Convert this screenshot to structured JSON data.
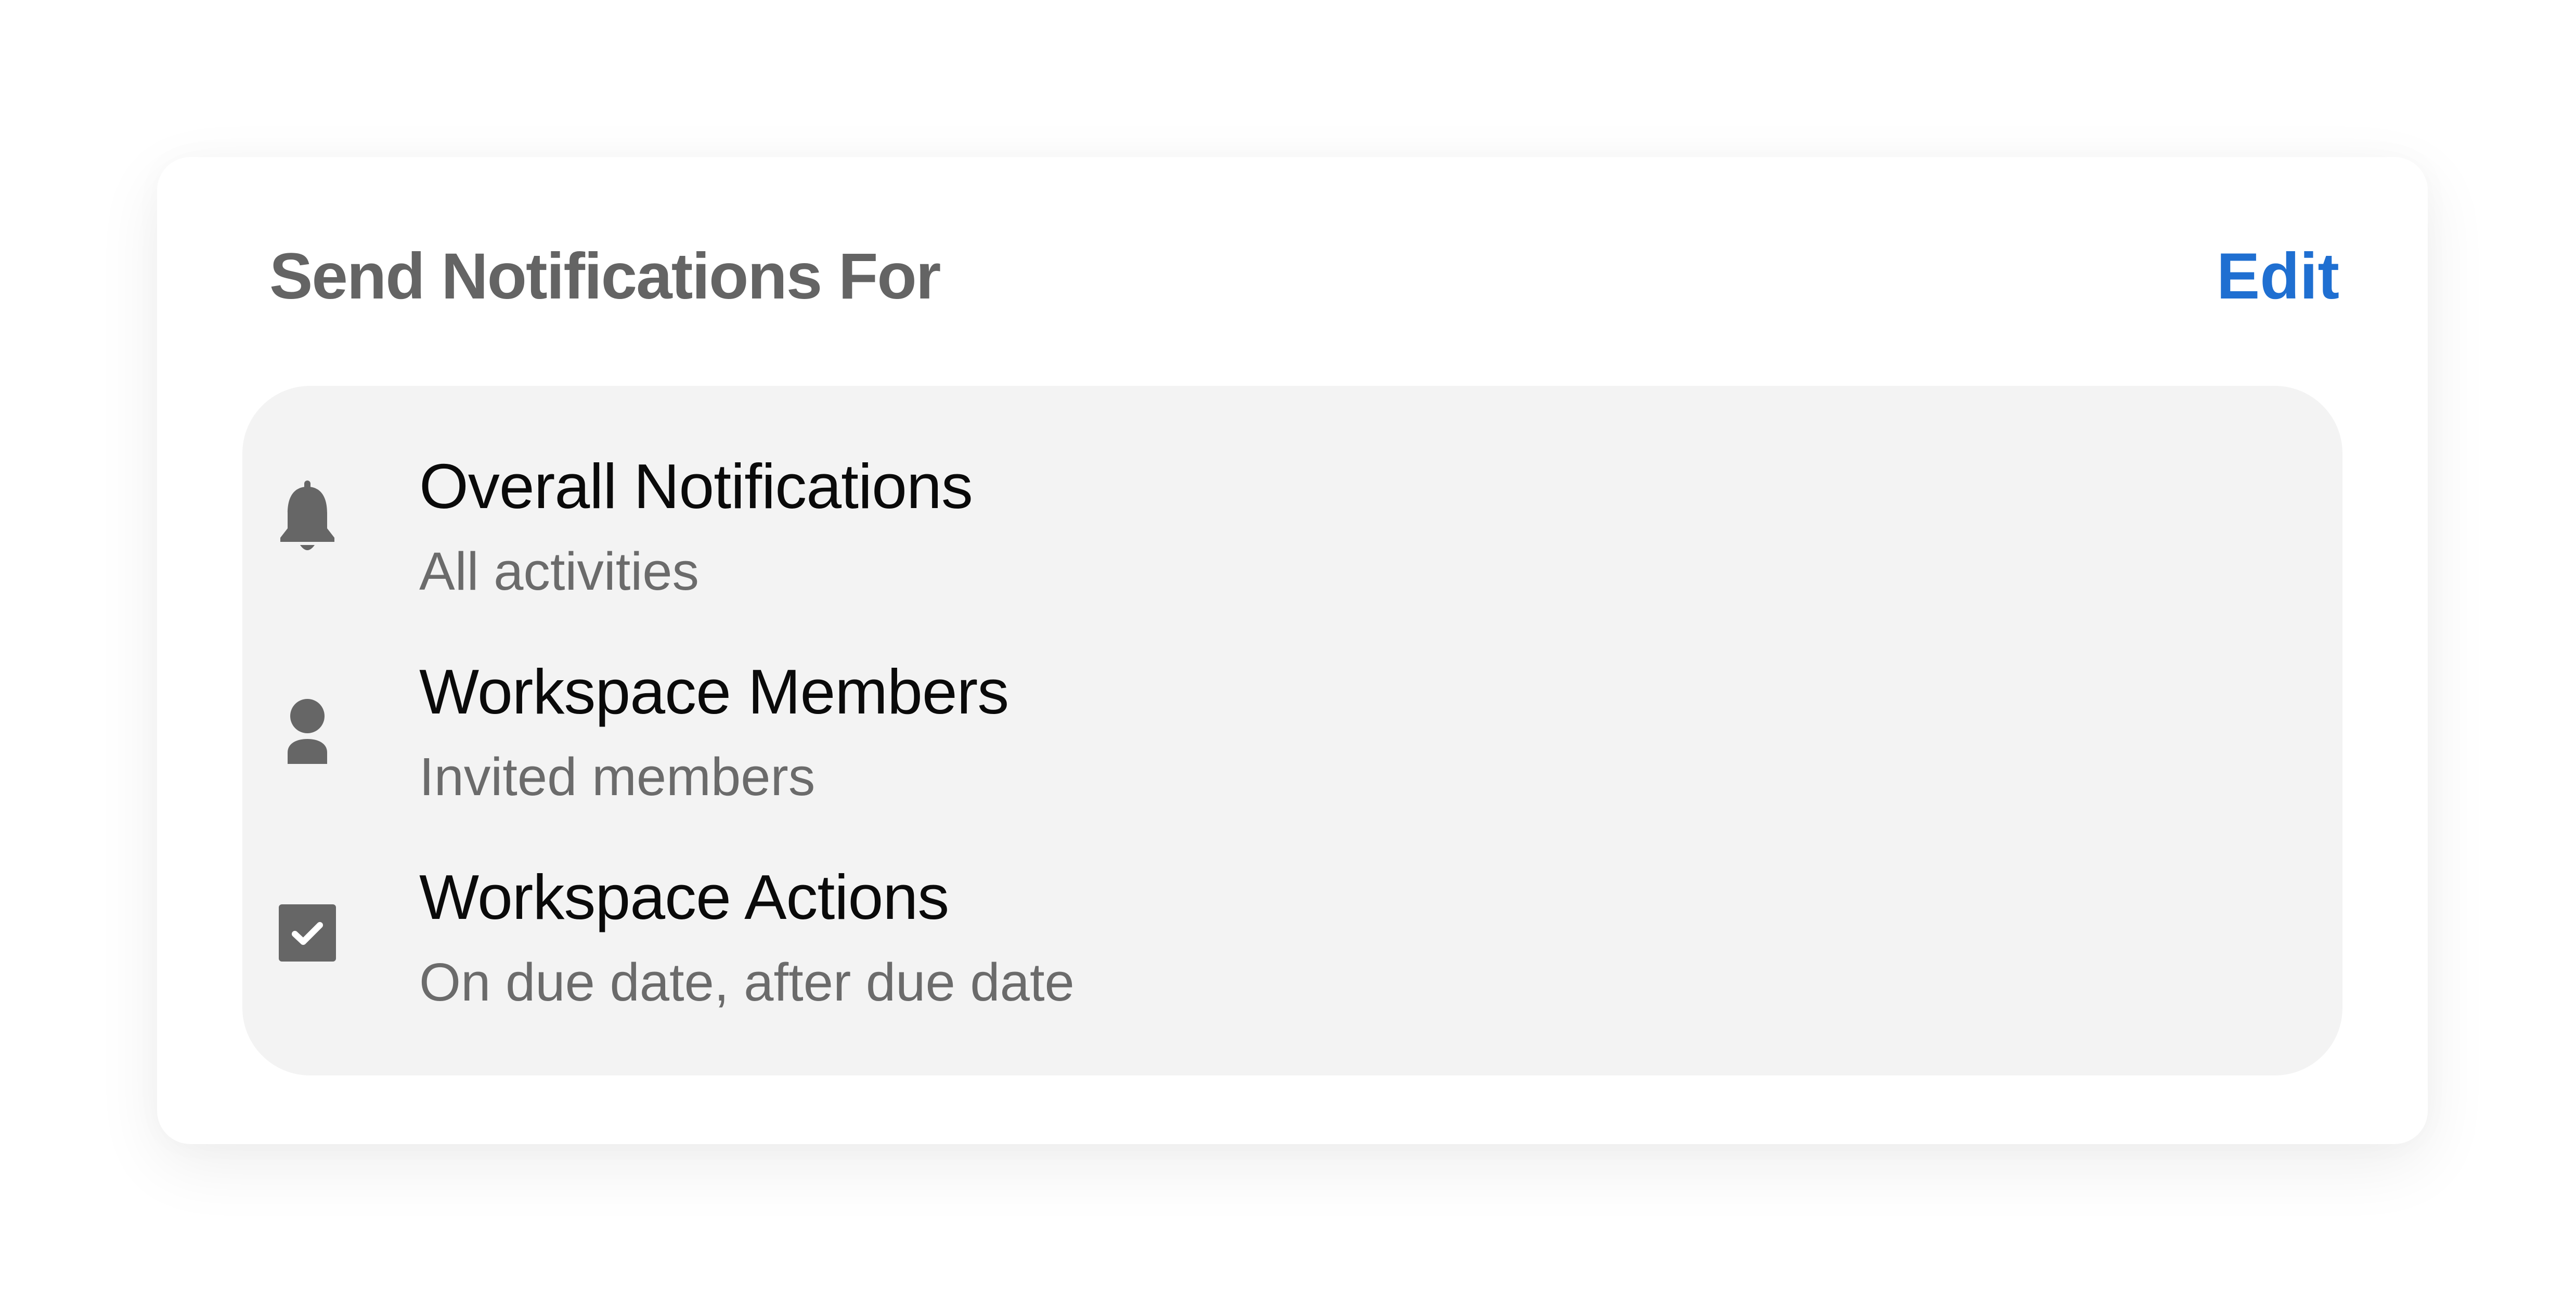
{
  "header": {
    "title": "Send Notifications For",
    "edit_label": "Edit"
  },
  "items": [
    {
      "title": "Overall Notifications",
      "subtitle": "All activities",
      "icon": "bell-icon"
    },
    {
      "title": "Workspace Members",
      "subtitle": "Invited members",
      "icon": "person-icon"
    },
    {
      "title": "Workspace Actions",
      "subtitle": "On due date, after due date",
      "icon": "checkbox-icon"
    }
  ],
  "colors": {
    "title_text": "#646464",
    "accent": "#1f6fd1",
    "panel_background": "#f3f3f3",
    "icon": "#666666",
    "item_title": "#0a0a0a",
    "item_subtitle": "#6b6b6b"
  }
}
